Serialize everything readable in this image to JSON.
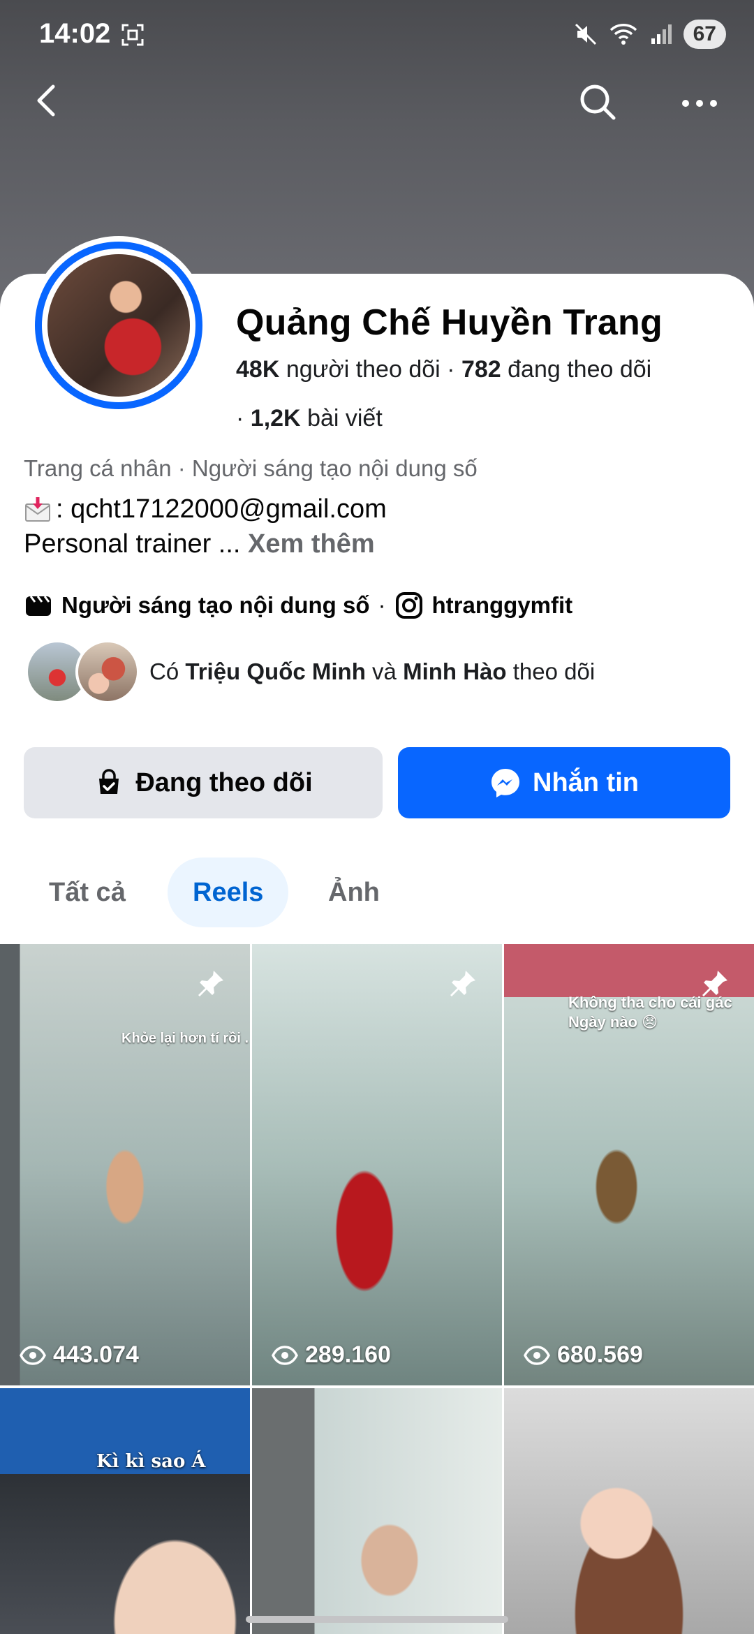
{
  "status_bar": {
    "time": "14:02",
    "battery": "67"
  },
  "profile": {
    "name": "Quảng Chế Huyền Trang",
    "followers_count": "48K",
    "followers_label": "người theo dõi",
    "following_count": "782",
    "following_label": "đang theo dõi",
    "posts_count": "1,2K",
    "posts_label": "bài viết",
    "category": "Trang cá nhân · Người sáng tạo nội dung số",
    "email_line": ": qcht17122000@gmail.com",
    "bio_text": "Personal trainer ... ",
    "see_more": "Xem thêm",
    "creator_tag": "Người sáng tạo nội dung số",
    "instagram_handle": "htranggymfit",
    "mutual_prefix": "Có",
    "mutual_name_1": "Triệu Quốc Minh",
    "mutual_and": "và",
    "mutual_name_2": "Minh Hào",
    "mutual_suffix": "theo dõi"
  },
  "actions": {
    "following_label": "Đang theo dõi",
    "message_label": "Nhắn tin"
  },
  "tabs": [
    {
      "label": "Tất cả",
      "active": false
    },
    {
      "label": "Reels",
      "active": true
    },
    {
      "label": "Ảnh",
      "active": false
    }
  ],
  "reels": [
    {
      "views": "443.074",
      "pinned": true,
      "overlay": "Khỏe lại hơn tí rồi ."
    },
    {
      "views": "289.160",
      "pinned": true,
      "overlay": ""
    },
    {
      "views": "680.569",
      "pinned": true,
      "overlay": "Không tha cho cái gác Ngày nào 😞"
    },
    {
      "views": "",
      "pinned": false,
      "overlay": "Kì kì sao Á"
    },
    {
      "views": "",
      "pinned": false,
      "overlay": ""
    },
    {
      "views": "",
      "pinned": false,
      "overlay": ""
    }
  ],
  "colors": {
    "brand_blue": "#0866ff",
    "active_tab_bg": "#ebf5ff",
    "active_tab_text": "#0064d1",
    "secondary_button_bg": "#e4e6eb",
    "muted_text": "#65676b"
  },
  "icons": {
    "back": "chevron-left-icon",
    "search": "search-icon",
    "more": "more-horizontal-icon",
    "following": "following-check-icon",
    "messenger": "messenger-icon",
    "creator": "clapperboard-icon",
    "instagram": "instagram-icon",
    "pin": "pin-icon",
    "views": "eye-icon",
    "email": "incoming-envelope-icon"
  }
}
